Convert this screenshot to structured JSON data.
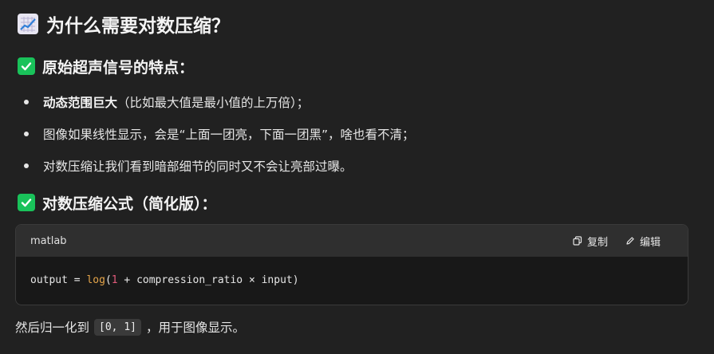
{
  "heading": {
    "text": "为什么需要对数压缩？",
    "icon": "chart-increasing-icon"
  },
  "section1": {
    "title": "原始超声信号的特点：",
    "icon": "check-mark-icon",
    "bullets": [
      {
        "bold": "动态范围巨大",
        "rest": "（比如最大值是最小值的上万倍）；"
      },
      {
        "bold": "",
        "rest": "图像如果线性显示，会是“上面一团亮，下面一团黑”，啥也看不清；"
      },
      {
        "bold": "",
        "rest": "对数压缩让我们看到暗部细节的同时又不会让亮部过曝。"
      }
    ]
  },
  "section2": {
    "title": "对数压缩公式（简化版）：",
    "icon": "check-mark-icon"
  },
  "code": {
    "language": "matlab",
    "copy_label": "复制",
    "edit_label": "编辑",
    "tokens": {
      "a": "output = ",
      "fn": "log",
      "b": "(",
      "num": "1",
      "c": " + compression_ratio × input)"
    }
  },
  "paragraph": {
    "before": "然后归一化到",
    "inline_code": "[0, 1]",
    "after": "，用于图像显示。"
  },
  "colors": {
    "background": "#212121",
    "check_green": "#19c25a",
    "code_fn": "#e5a54a",
    "code_number": "#e05a7a"
  }
}
